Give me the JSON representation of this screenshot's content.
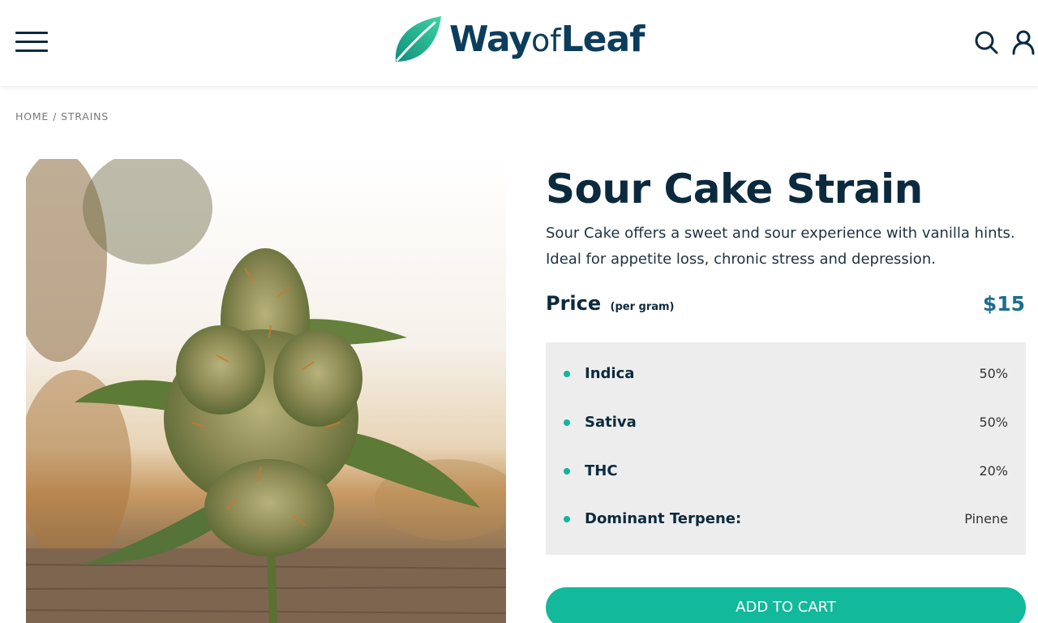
{
  "header": {
    "brand": {
      "prefix": "Way",
      "middle": "of",
      "suffix": "Leaf"
    },
    "icons": {
      "menu": "hamburger-menu-icon",
      "search": "search-icon",
      "account": "user-icon",
      "logo": "leaf-icon"
    }
  },
  "breadcrumb": {
    "items": [
      "HOME",
      "STRAINS"
    ],
    "separator": "/"
  },
  "product": {
    "title": "Sour Cake Strain",
    "description": "Sour Cake offers a sweet and sour experience with vanilla hints. Ideal for appetite loss, chronic stress and depression.",
    "price_label": "Price",
    "price_unit": "(per gram)",
    "price": "$15",
    "specs": [
      {
        "name": "Indica",
        "value": "50%"
      },
      {
        "name": "Sativa",
        "value": "50%"
      },
      {
        "name": "THC",
        "value": "20%"
      },
      {
        "name": "Dominant Terpene:",
        "value": "Pinene"
      }
    ],
    "cta": "ADD TO CART"
  },
  "colors": {
    "accent": "#12b99b",
    "navy": "#0c2a3e",
    "price": "#1c6e8c",
    "panel": "#ededed"
  }
}
